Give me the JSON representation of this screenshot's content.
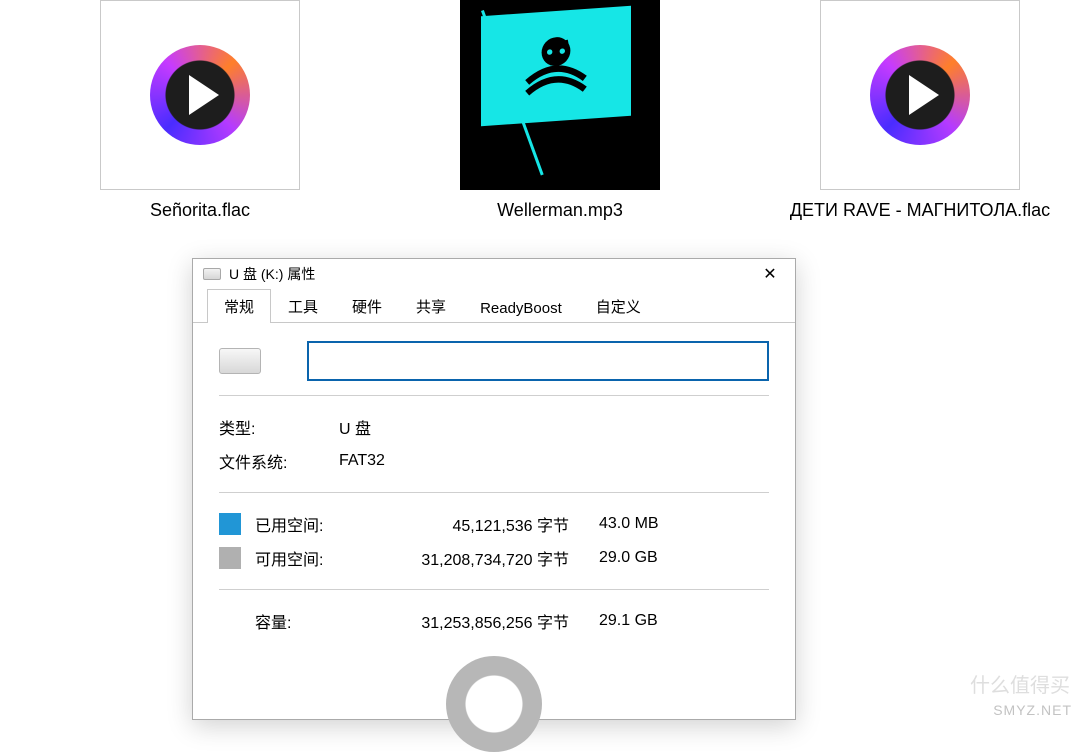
{
  "files": [
    {
      "name": "Señorita.flac",
      "kind": "generic-audio"
    },
    {
      "name": "Wellerman.mp3",
      "kind": "album-art"
    },
    {
      "name": "ДЕТИ RAVE - МАГНИТОЛА.flac",
      "kind": "generic-audio"
    }
  ],
  "dialog": {
    "title": "U 盘 (K:) 属性",
    "tabs": [
      "常规",
      "工具",
      "硬件",
      "共享",
      "ReadyBoost",
      "自定义"
    ],
    "active_tab_index": 0,
    "volume_name": "",
    "type_label": "类型:",
    "type_value": "U 盘",
    "filesystem_label": "文件系统:",
    "filesystem_value": "FAT32",
    "used": {
      "label": "已用空间:",
      "bytes": "45,121,536 字节",
      "friendly": "43.0 MB",
      "color": "#2196d6"
    },
    "free": {
      "label": "可用空间:",
      "bytes": "31,208,734,720 字节",
      "friendly": "29.0 GB",
      "color": "#b0b0b0"
    },
    "capacity": {
      "label": "容量:",
      "bytes": "31,253,856,256 字节",
      "friendly": "29.1 GB"
    }
  },
  "watermark": {
    "latin": "SMYZ.NET",
    "cn": "什么值得买"
  }
}
